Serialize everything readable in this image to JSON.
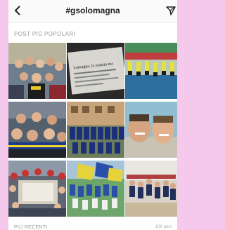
{
  "header": {
    "title": "#gsolomagna",
    "back_icon": "chevron-left-icon",
    "send_icon": "paper-plane-icon"
  },
  "sections": {
    "top_label": "POST PIÙ POPOLARI",
    "recent_label": "PIÙ RECENTI",
    "recent_count": "100 post"
  },
  "posts": [
    {
      "id": "post-1",
      "alt": "group of students posing"
    },
    {
      "id": "post-2",
      "alt": "newspaper article",
      "text": "Lomagna, la notizia era"
    },
    {
      "id": "post-3",
      "alt": "volleyball team in gym"
    },
    {
      "id": "post-4",
      "alt": "group selfie with scarves"
    },
    {
      "id": "post-5",
      "alt": "team photo in front of building"
    },
    {
      "id": "post-6",
      "alt": "two guys selfie"
    },
    {
      "id": "post-7",
      "alt": "group around table indoors"
    },
    {
      "id": "post-8",
      "alt": "team with flags on field"
    },
    {
      "id": "post-9",
      "alt": "volleyball players on court"
    }
  ],
  "colors": {
    "page_bg": "#f4c9ec",
    "header_bg": "#fafafa"
  }
}
